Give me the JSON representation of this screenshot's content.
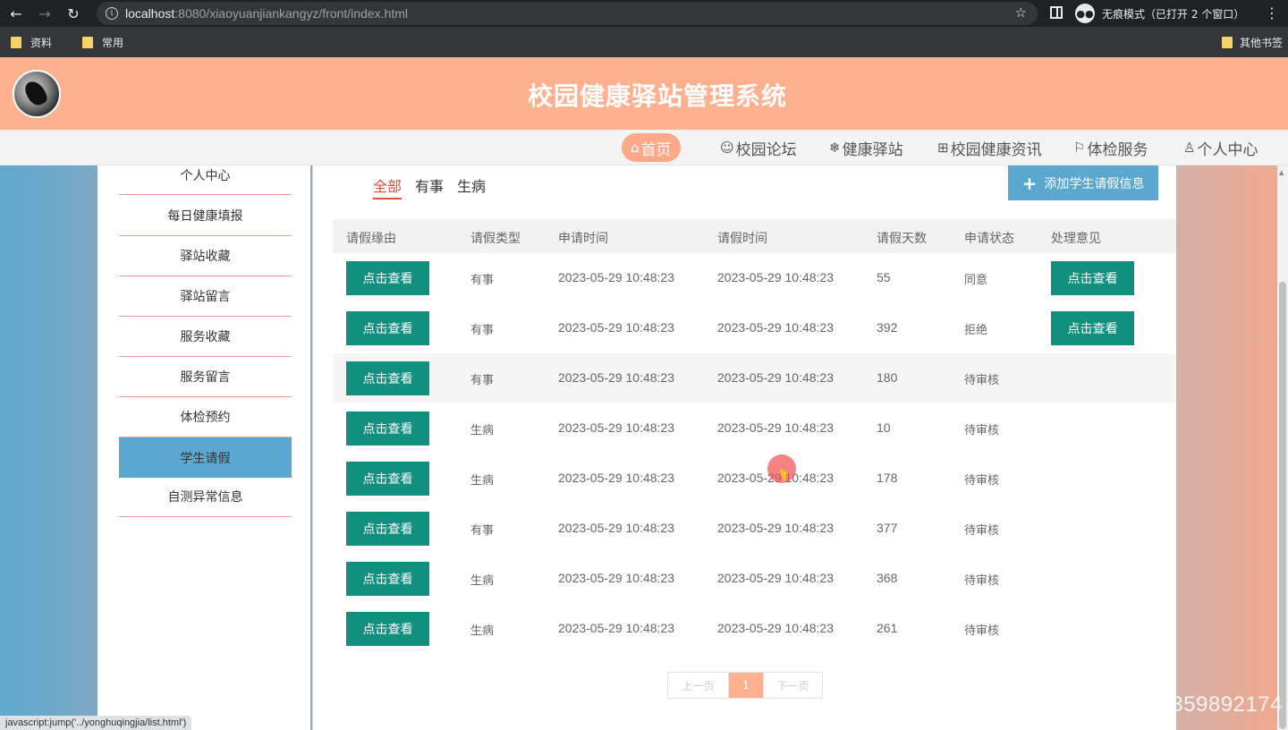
{
  "browser": {
    "url_host": "localhost",
    "url_rest": ":8080/xiaoyuanjiankangyz/front/index.html",
    "incognito_label": "无痕模式（已打开 2 个窗口）",
    "bookmarks": [
      "资料",
      "常用"
    ],
    "other_bookmarks": "其他书签",
    "status_url": "javascript:jump('../yonghuqingjia/list.html')"
  },
  "header": {
    "title": "校园健康驿站管理系统"
  },
  "nav": [
    {
      "icon": "⌂",
      "label": "首页"
    },
    {
      "icon": "☺",
      "label": "校园论坛"
    },
    {
      "icon": "❄",
      "label": "健康驿站"
    },
    {
      "icon": "⊞",
      "label": "校园健康资讯"
    },
    {
      "icon": "⚐",
      "label": "体检服务"
    },
    {
      "icon": "♙",
      "label": "个人中心"
    }
  ],
  "sidebar": {
    "items": [
      "个人中心",
      "每日健康填报",
      "驿站收藏",
      "驿站留言",
      "服务收藏",
      "服务留言",
      "体检预约",
      "学生请假",
      "自测异常信息"
    ],
    "active_index": 7
  },
  "filters": [
    "全部",
    "有事",
    "生病"
  ],
  "add_button": "添加学生请假信息",
  "table": {
    "headers": [
      "请假缘由",
      "请假类型",
      "申请时间",
      "请假时间",
      "请假天数",
      "申请状态",
      "处理意见"
    ],
    "view_label": "点击查看",
    "rows": [
      {
        "type": "有事",
        "apply_time": "2023-05-29 10:48:23",
        "leave_time": "2023-05-29 10:48:23",
        "days": "55",
        "status": "同意",
        "has_opinion": true
      },
      {
        "type": "有事",
        "apply_time": "2023-05-29 10:48:23",
        "leave_time": "2023-05-29 10:48:23",
        "days": "392",
        "status": "拒绝",
        "has_opinion": true
      },
      {
        "type": "有事",
        "apply_time": "2023-05-29 10:48:23",
        "leave_time": "2023-05-29 10:48:23",
        "days": "180",
        "status": "待审核",
        "has_opinion": false
      },
      {
        "type": "生病",
        "apply_time": "2023-05-29 10:48:23",
        "leave_time": "2023-05-29 10:48:23",
        "days": "10",
        "status": "待审核",
        "has_opinion": false
      },
      {
        "type": "生病",
        "apply_time": "2023-05-29 10:48:23",
        "leave_time": "2023-05-29 10:48:23",
        "days": "178",
        "status": "待审核",
        "has_opinion": false
      },
      {
        "type": "有事",
        "apply_time": "2023-05-29 10:48:23",
        "leave_time": "2023-05-29 10:48:23",
        "days": "377",
        "status": "待审核",
        "has_opinion": false
      },
      {
        "type": "生病",
        "apply_time": "2023-05-29 10:48:23",
        "leave_time": "2023-05-29 10:48:23",
        "days": "368",
        "status": "待审核",
        "has_opinion": false
      },
      {
        "type": "生病",
        "apply_time": "2023-05-29 10:48:23",
        "leave_time": "2023-05-29 10:48:23",
        "days": "261",
        "status": "待审核",
        "has_opinion": false
      }
    ]
  },
  "pager": {
    "prev": "上一页",
    "current": "1",
    "next": "下一页"
  },
  "watermark": "CSDN @QQ3359892174"
}
